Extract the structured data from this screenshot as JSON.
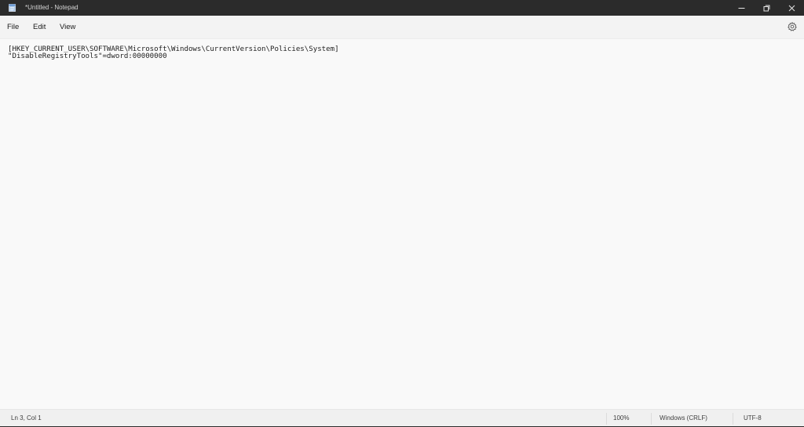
{
  "window": {
    "title": "*Untitled - Notepad"
  },
  "menu": {
    "items": [
      {
        "label": "File"
      },
      {
        "label": "Edit"
      },
      {
        "label": "View"
      }
    ]
  },
  "editor": {
    "lines": [
      "[HKEY_CURRENT_USER\\SOFTWARE\\Microsoft\\Windows\\CurrentVersion\\Policies\\System]",
      "\"DisableRegistryTools\"=dword:00000000"
    ]
  },
  "status": {
    "position": "Ln 3, Col 1",
    "zoom": "100%",
    "line_ending": "Windows (CRLF)",
    "encoding": "UTF-8"
  },
  "icons": {
    "app": "notepad-icon",
    "minimize": "minimize-icon",
    "maximize": "restore-icon",
    "close": "close-icon",
    "settings": "gear-icon"
  },
  "colors": {
    "titlebar": "#2b2b2b",
    "menubar": "#f3f3f3",
    "editor_bg": "#f9f9f9",
    "statusbar": "#f0f0f0"
  }
}
